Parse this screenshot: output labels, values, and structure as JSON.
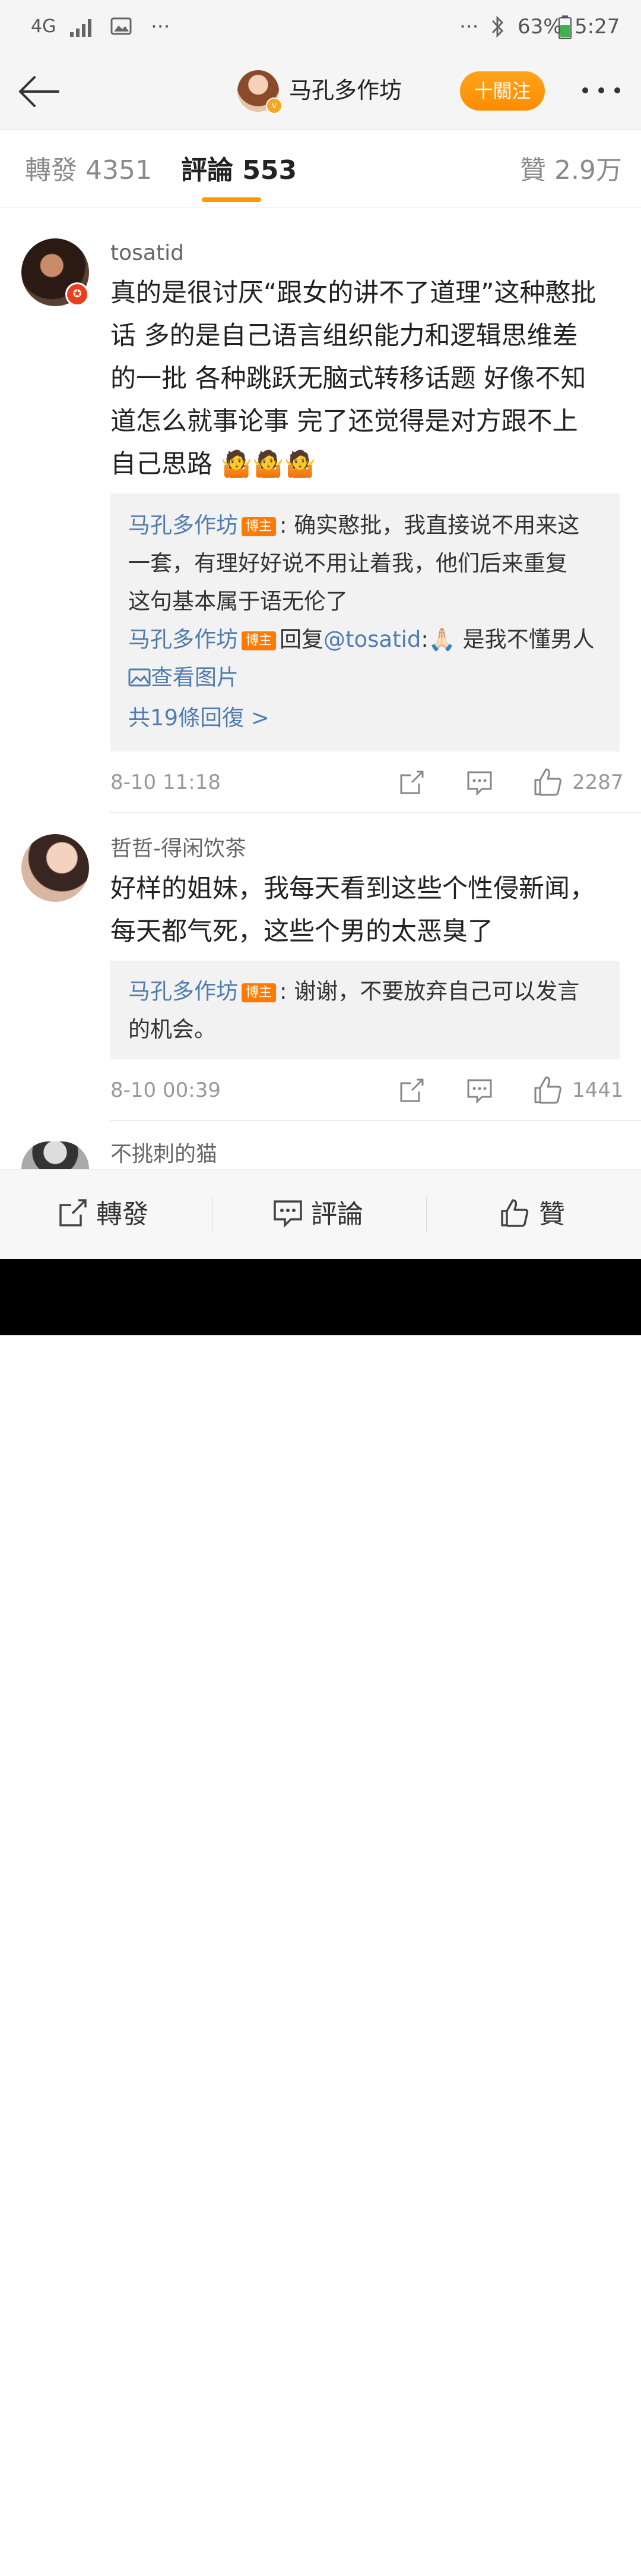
{
  "status_bar": {
    "network": "4G",
    "more_left": "···",
    "more_right": "···",
    "battery": "63%",
    "time": "5:27"
  },
  "header": {
    "title": "马孔多作坊",
    "follow_label": "十關注"
  },
  "tabs": [
    {
      "label": "轉發 4351"
    },
    {
      "label": "評論 553"
    },
    {
      "label": "贊 2.9万"
    }
  ],
  "comments": [
    {
      "username": "tosatid",
      "lines": [
        "真的是很讨厌“跟女的讲不了道理”这种憨批",
        "话 多的是自己语言组织能力和逻辑思维差",
        "的一批 各种跳跃无脑式转移话题 好像不知",
        "道怎么就事论事 完了还觉得是对方跟不上",
        "自己思路 🤷🤷🤷"
      ],
      "reply1_author": "马孔多作坊",
      "reply1_lines": [
        ": 确实憨批，我直接说不用来这",
        "一套，有理好好说不用让着我，他们后来重复",
        "这句基本属于语无伦了"
      ],
      "reply2_author": "马孔多作坊",
      "reply2_prefix": "回复",
      "reply2_mention": "@tosatid",
      "reply2_text": ":🙏🏻 是我不懂男人",
      "view_image": "查看图片",
      "more_replies": "共19條回復 >",
      "time": "8-10 11:18",
      "likes": "2287"
    },
    {
      "username": "哲哲-得闲饮茶",
      "lines": [
        "好样的姐妹，我每天看到这些个性侵新闻，",
        "每天都气死，这些个男的太恶臭了"
      ],
      "reply1_author": "马孔多作坊",
      "reply1_lines": [
        ": 谢谢，不要放弃自己可以发言",
        "的机会。"
      ],
      "time": "8-10 00:39",
      "likes": "1441"
    },
    {
      "username": "不挑刺的猫"
    }
  ],
  "badge": "博主",
  "bottom_bar": {
    "repost": "轉發",
    "comment": "評論",
    "like": "贊"
  }
}
